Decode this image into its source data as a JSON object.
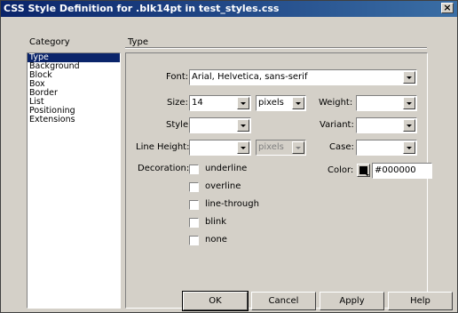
{
  "window": {
    "title": "CSS Style Definition for .blk14pt in test_styles.css",
    "close": "×"
  },
  "category": {
    "header": "Category",
    "items": [
      "Type",
      "Background",
      "Block",
      "Box",
      "Border",
      "List",
      "Positioning",
      "Extensions"
    ],
    "selected": "Type"
  },
  "panel": {
    "header": "Type"
  },
  "form": {
    "font_label": "Font:",
    "font_value": "Arial, Helvetica, sans-serif",
    "size_label": "Size:",
    "size_value": "14",
    "size_unit": "pixels",
    "weight_label": "Weight:",
    "weight_value": "",
    "style_label": "Style:",
    "style_value": "",
    "variant_label": "Variant:",
    "variant_value": "",
    "lineheight_label": "Line Height:",
    "lineheight_value": "",
    "lineheight_unit": "pixels",
    "case_label": "Case:",
    "case_value": "",
    "decoration_label": "Decoration:",
    "decorations": [
      "underline",
      "overline",
      "line-through",
      "blink",
      "none"
    ],
    "color_label": "Color:",
    "color_value": "#000000"
  },
  "buttons": {
    "ok": "OK",
    "cancel": "Cancel",
    "apply": "Apply",
    "help": "Help"
  }
}
